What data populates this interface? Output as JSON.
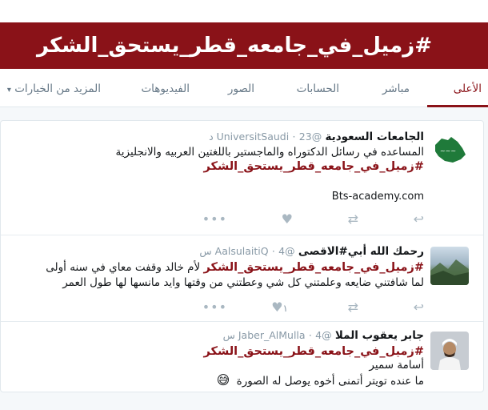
{
  "banner": {
    "title": "#زميل_في_جامعه_قطر_يستحق_الشكر"
  },
  "tabs": [
    {
      "label": "الأعلى",
      "active": true
    },
    {
      "label": "مباشر",
      "active": false
    },
    {
      "label": "الحسابات",
      "active": false
    },
    {
      "label": "الصور",
      "active": false
    },
    {
      "label": "الفيديوهات",
      "active": false
    },
    {
      "label": "المزيد من الخيارات",
      "active": false
    }
  ],
  "tweets": [
    {
      "name": "الجامعات السعودية",
      "handle": "@UniversitSaudi",
      "time": "23 د",
      "lines": [
        "المساعده في رسائل الدكتوراه والماجستير باللغتين العربيه والانجليزية"
      ],
      "hashtag": "#زميل_في_جامعه_قطر_يستحق_الشكر",
      "link": "Bts-academy.com",
      "like_count": ""
    },
    {
      "name": "رحمك الله أبي#الاقصى",
      "handle": "@AalsulaitiQ",
      "time": "4 س",
      "lead_text": " لأم خالد وقفت معاي في سنه أولى",
      "hashtag": "#زميل_في_جامعه_قطر_يستحق_الشكر",
      "lines": [
        "لما شافتني ضايعه وعلمتني كل شي وعطتني من وقتها وايد مانسها لها طول العمر"
      ],
      "like_count": "١"
    },
    {
      "name": "جابر يعقوب الملا",
      "handle": "@Jaber_AlMulla",
      "time": "4 س",
      "hashtag": "#زميل_في_جامعه_قطر_يستحق_الشكر",
      "lines": [
        "أسامة سمير",
        "ما عنده تويتر أتمنى أخوه يوصل له الصورة"
      ],
      "emoji": "😅"
    }
  ],
  "colors": {
    "brand": "#8a1218",
    "muted": "#8899a6",
    "icon": "#aab8c2"
  },
  "icons": {
    "reply": "reply-icon",
    "retweet": "retweet-icon",
    "like": "heart-icon",
    "more": "more-icon"
  }
}
